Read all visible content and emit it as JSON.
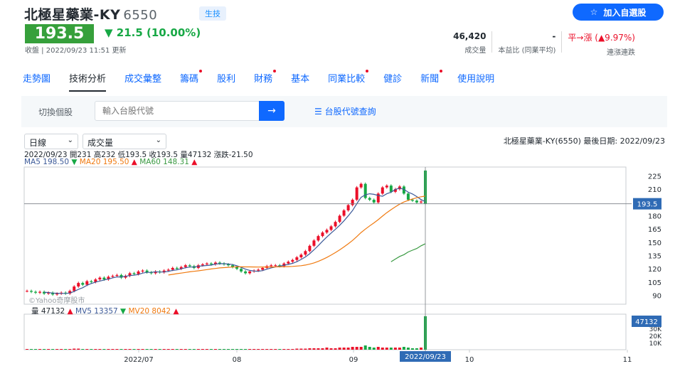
{
  "header": {
    "stock_name": "北極星藥業-KY",
    "stock_code": "6550",
    "tag": "生技",
    "watch_button": "加入自選股"
  },
  "quote": {
    "price": "193.5",
    "change": "▼ 21.5 (10.00%)",
    "updated": "收盤 | 2022/09/23 11:51 更新"
  },
  "stats": [
    {
      "value": "46,420",
      "label": "成交量"
    },
    {
      "value": "-",
      "label": "本益比 (同業平均)"
    },
    {
      "value": "平→漲 (▲9.97%)",
      "label": "連漲連跌"
    }
  ],
  "tabs": [
    {
      "label": "走勢圖",
      "dot": false,
      "active": false
    },
    {
      "label": "技術分析",
      "dot": false,
      "active": true
    },
    {
      "label": "成交彙整",
      "dot": false,
      "active": false
    },
    {
      "label": "籌碼",
      "dot": true,
      "active": false
    },
    {
      "label": "股利",
      "dot": false,
      "active": false
    },
    {
      "label": "財務",
      "dot": true,
      "active": false
    },
    {
      "label": "基本",
      "dot": false,
      "active": false
    },
    {
      "label": "同業比較",
      "dot": true,
      "active": false
    },
    {
      "label": "健診",
      "dot": false,
      "active": false
    },
    {
      "label": "新聞",
      "dot": true,
      "active": false
    },
    {
      "label": "使用說明",
      "dot": false,
      "active": false
    }
  ],
  "search": {
    "label": "切換個股",
    "placeholder": "輸入台股代號",
    "link": "台股代號查詢"
  },
  "controls": {
    "period": "日線",
    "indicator": "成交量",
    "info": "北極星藥業-KY(6550)   最後日期: 2022/09/23"
  },
  "ohlc_text": "2022/09/23 開231 高232 低193.5 收193.5 量47132 漲跌-21.50",
  "ma": {
    "ma5": "MA5 198.50",
    "ma20": "MA20 195.50",
    "ma60": "MA60 148.31"
  },
  "volume_legend": {
    "vol": "量 47132",
    "mv5": "MV5 13357",
    "mv20": "MV20 8042"
  },
  "chart_data": {
    "type": "candlestick",
    "price_axis_ticks": [
      90,
      105,
      120,
      135,
      150,
      165,
      180,
      195,
      210,
      225
    ],
    "volume_axis_ticks": [
      "10K",
      "20K",
      "30K"
    ],
    "x_labels": [
      "2022/07",
      "08",
      "09",
      "10",
      "11"
    ],
    "last_price_label": "193.5",
    "last_volume_label": "47132",
    "crosshair_date": "2022/09/23",
    "watermark": "©Yahoo奇摩股市",
    "closes": [
      95,
      94,
      93,
      94,
      92,
      93,
      91,
      92,
      93,
      92,
      95,
      100,
      104,
      102,
      106,
      105,
      108,
      110,
      108,
      111,
      112,
      113,
      110,
      112,
      115,
      114,
      117,
      118,
      116,
      115,
      117,
      116,
      118,
      119,
      121,
      120,
      122,
      124,
      123,
      121,
      124,
      125,
      126,
      125,
      127,
      126,
      125,
      124,
      122,
      120,
      117,
      115,
      117,
      118,
      119,
      121,
      123,
      124,
      124,
      123,
      126,
      128,
      130,
      133,
      136,
      140,
      146,
      152,
      157,
      161,
      164,
      168,
      173,
      180,
      186,
      192,
      198,
      212,
      216,
      200,
      198,
      195,
      205,
      212,
      214,
      207,
      210,
      213,
      205,
      198,
      197,
      195,
      196,
      193.5
    ],
    "ma20_start_index": 33,
    "ma60_start_index": 85,
    "ma60_values": [
      128,
      131,
      134,
      136,
      139,
      141,
      143,
      146,
      148.31
    ],
    "volumes_k": [
      1,
      1,
      1,
      1,
      1,
      1,
      1,
      1,
      1,
      1,
      1,
      1.5,
      1.5,
      1,
      1,
      1,
      1,
      1,
      1,
      1,
      1,
      1,
      1,
      1,
      1,
      1,
      1,
      1,
      1,
      1,
      1,
      1,
      1,
      1,
      1,
      1,
      1,
      1,
      1,
      1,
      1,
      1,
      1,
      1,
      1,
      1,
      1,
      1,
      1,
      1,
      1,
      1,
      1,
      1,
      1,
      1,
      1,
      1,
      1,
      1,
      1,
      1,
      1,
      1.5,
      1.5,
      1.5,
      2,
      2,
      2,
      2,
      3,
      2,
      2,
      3,
      3,
      3,
      4,
      4,
      4,
      6,
      4,
      3,
      4,
      3,
      3,
      3,
      3,
      3,
      4,
      3,
      2,
      2,
      3,
      47.132
    ]
  }
}
